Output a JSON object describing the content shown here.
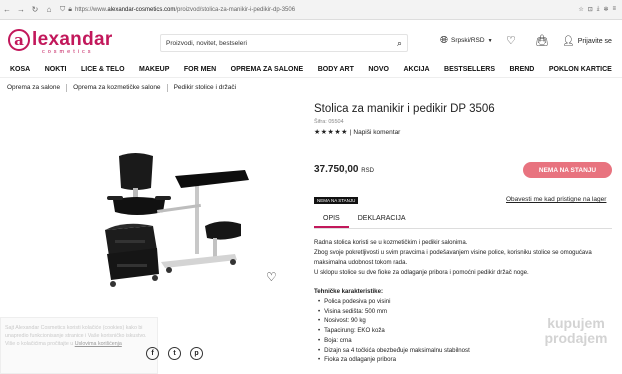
{
  "browser": {
    "url_prefix": "https://www.",
    "url_host": "alexandar-cosmetics.com",
    "url_path": "/proizvod/stolica-za-manikir-i-pedikir-dp-3506"
  },
  "logo": {
    "mark": "a",
    "word": "lexandar",
    "sub": "cosmetics"
  },
  "search": {
    "placeholder": "Proizvodi, novitet, bestseleri"
  },
  "lang": {
    "label": "Srpski/RSD"
  },
  "login": {
    "label": "Prijavite se"
  },
  "nav": {
    "items": [
      {
        "label": "KOSA"
      },
      {
        "label": "NOKTI"
      },
      {
        "label": "LICE & TELO"
      },
      {
        "label": "MAKEUP"
      },
      {
        "label": "FOR MEN"
      },
      {
        "label": "OPREMA ZA SALONE"
      },
      {
        "label": "BODY ART"
      },
      {
        "label": "NOVO"
      },
      {
        "label": "AKCIJA"
      },
      {
        "label": "BESTSELLERS"
      },
      {
        "label": "BREND"
      },
      {
        "label": "POKLON KARTICE"
      }
    ]
  },
  "breadcrumbs": {
    "items": [
      {
        "label": "Oprema za salone"
      },
      {
        "label": "Oprema za kozmetičke salone"
      },
      {
        "label": "Pedikir stolice i držači"
      }
    ]
  },
  "product": {
    "title": "Stolica za manikir i pedikir DP 3506",
    "sku": "Šifra: 05504",
    "stars": "★★★★★",
    "review_link": "| Napiši komentar",
    "price": "37.750,00",
    "currency": "RSD",
    "out_of_stock_button": "NEMA NA STANJU",
    "badge": "NEMA NA STANJU",
    "notify_link": "Obavesti me kad pristigne na lager"
  },
  "tabs": {
    "opis": "OPIS",
    "deklaracija": "DEKLARACIJA"
  },
  "description": {
    "lines": [
      "Radna stolica koristi se u kozmetičkim i pedikir salonima.",
      "Zbog svoje pokretljivosti u svim pravcima i podešavanjem visine police, korisniku stolice se omogućava maksimalna udobnost tokom rada.",
      "U sklopu stolice su dve fioke za odlaganje pribora i pomoćni pedikir držač noge."
    ],
    "spec_title": "Tehničke karakteristike:",
    "specs": [
      "Polica podesiva po visini",
      "Visina sedišta: 500 mm",
      "Nosivost: 90 kg",
      "Tapacirung: EKO koža",
      "Boja: crna",
      "Dizajn sa 4 točkića obezbeđuje maksimalnu stabilnost",
      "Fioka za odlaganje pribora"
    ]
  },
  "cookie": {
    "text": "Sajt Alexandar Cosmetics koristi kolačiće (cookies) kako bi unapredio funkcionisanje stranice i Vaše korisničko iskustvo. Više o kolačićima pročitajte u",
    "link": "Uslovima korišćenja"
  },
  "share": {
    "facebook": "f",
    "twitter": "t",
    "pinterest": "p"
  },
  "watermark": {
    "line1": "kupujem",
    "line2": "prodajem"
  },
  "colors": {
    "brand": "#c2185b",
    "button": "#e8737f"
  }
}
